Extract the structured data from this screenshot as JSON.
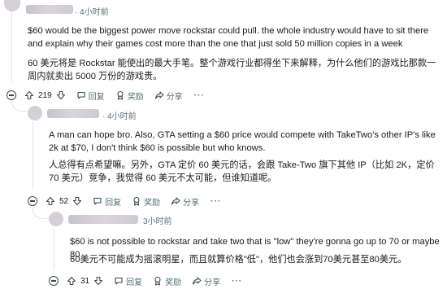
{
  "comments": [
    {
      "time": "· 4小时前",
      "text_en": "$60 would be the biggest power move rockstar could pull. the whole industry would have to sit there and explain why their games cost more than the one that just sold 50 million copies in a week",
      "text_zh": "60 美元将是 Rockstar 能使出的最大手笔。整个游戏行业都得坐下来解释，为什么他们的游戏比那款一周内就卖出 5000 万份的游戏贵。",
      "votes": "219"
    },
    {
      "time": "· 4小时前",
      "text_en": "A man can hope bro. Also, GTA setting a $60 price would compete with TakeTwo's other IP's like 2k at $70, I don't think $60 is possible but who knows.",
      "text_zh": "人总得有点希望嘛。另外，GTA 定价 60 美元的话，会跟 Take-Two 旗下其他 IP（比如 2K，定价 70 美元）竞争，我觉得 60 美元不太可能，但谁知道呢。",
      "votes": "52"
    },
    {
      "time": "3小时前",
      "text_en": "$60 is not possible to rockstar and take two that is \"low\" they're gonna go up to 70 or maybe 80",
      "text_zh": "60美元不可能成为摇滚明星，而且就算价格\"低\"，他们也会涨到70美元甚至80美元。",
      "votes": "31"
    }
  ],
  "actions": {
    "reply": "回复",
    "award": "奖励",
    "share": "分享",
    "more": "···"
  },
  "icons": {
    "collapse": "collapse-icon",
    "upvote": "upvote-arrow-icon",
    "downvote": "downvote-arrow-icon",
    "reply": "speech-bubble-icon",
    "award": "award-icon",
    "share": "share-arrow-icon"
  }
}
